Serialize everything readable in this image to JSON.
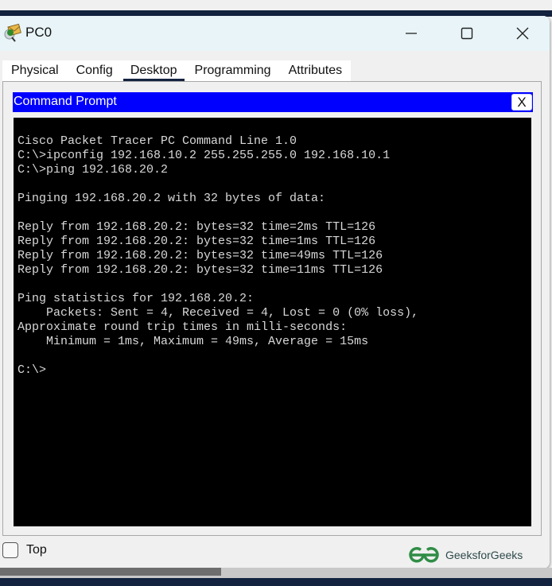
{
  "window": {
    "title": "PC0",
    "app_icon": "cisco-pc-icon",
    "controls": {
      "minimize_icon": "minimize-icon",
      "maximize_icon": "maximize-icon",
      "close_icon": "close-icon"
    }
  },
  "tabs": [
    {
      "label": "Physical",
      "active": false
    },
    {
      "label": "Config",
      "active": false
    },
    {
      "label": "Desktop",
      "active": true
    },
    {
      "label": "Programming",
      "active": false
    },
    {
      "label": "Attributes",
      "active": false
    }
  ],
  "command_prompt": {
    "title": "Command Prompt",
    "close_label": "X",
    "header_color": "#0000ff",
    "lines": [
      "Cisco Packet Tracer PC Command Line 1.0",
      "C:\\>ipconfig 192.168.10.2 255.255.255.0 192.168.10.1",
      "C:\\>ping 192.168.20.2",
      "",
      "Pinging 192.168.20.2 with 32 bytes of data:",
      "",
      "Reply from 192.168.20.2: bytes=32 time=2ms TTL=126",
      "Reply from 192.168.20.2: bytes=32 time=1ms TTL=126",
      "Reply from 192.168.20.2: bytes=32 time=49ms TTL=126",
      "Reply from 192.168.20.2: bytes=32 time=11ms TTL=126",
      "",
      "Ping statistics for 192.168.20.2:",
      "    Packets: Sent = 4, Received = 4, Lost = 0 (0% loss),",
      "Approximate round trip times in milli-seconds:",
      "    Minimum = 1ms, Maximum = 49ms, Average = 15ms",
      "",
      "C:\\>"
    ]
  },
  "footer": {
    "top_checkbox_label": "Top",
    "top_checked": false,
    "watermark": "GeeksforGeeks",
    "watermark_color": "#2f8d46"
  }
}
